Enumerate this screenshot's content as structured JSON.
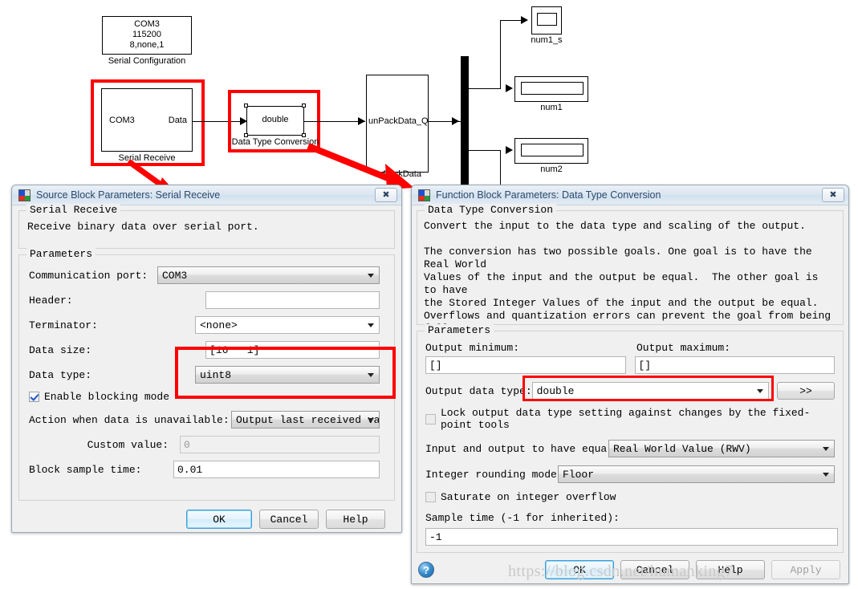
{
  "diagram": {
    "blocks": [
      {
        "name": "serial-configuration",
        "lines": [
          "COM3",
          "115200",
          "8,none,1"
        ],
        "caption": "Serial Configuration"
      },
      {
        "name": "serial-receive",
        "port_in": "COM3",
        "port_out": "Data",
        "caption": "Serial Receive"
      },
      {
        "name": "data-type-conversion",
        "text": "double",
        "caption": "Data Type Conversion"
      },
      {
        "name": "unpackdata",
        "text": "unPackData_Q",
        "caption": "unPackData"
      },
      {
        "name": "display-num1-s",
        "caption": "num1_s"
      },
      {
        "name": "display-num1",
        "caption": "num1"
      },
      {
        "name": "display-num2",
        "caption": "num2"
      }
    ]
  },
  "serial_receive_dialog": {
    "title": "Source Block Parameters: Serial Receive",
    "close_glyph": "✖",
    "group_block": {
      "title": "Serial Receive",
      "description": "Receive binary data over serial port."
    },
    "group_params": {
      "title": "Parameters",
      "communication_port": {
        "label": "Communication port:",
        "value": "COM3"
      },
      "header": {
        "label": "Header:",
        "value": ""
      },
      "terminator": {
        "label": "Terminator:",
        "value": "<none>"
      },
      "data_size": {
        "label": "Data size:",
        "value": "[16   1]"
      },
      "data_type": {
        "label": "Data type:",
        "value": "uint8"
      },
      "enable_blocking": {
        "label": "Enable blocking mode",
        "checked": true
      },
      "action_unavailable": {
        "label": "Action when data is unavailable:",
        "value": "Output last received value"
      },
      "custom_value": {
        "label": "Custom value:",
        "value": "0",
        "disabled": true
      },
      "block_sample_time": {
        "label": "Block sample time:",
        "value": "0.01"
      }
    },
    "buttons": {
      "ok": "OK",
      "cancel": "Cancel",
      "help": "Help"
    }
  },
  "data_type_conversion_dialog": {
    "title": "Function Block Parameters: Data Type Conversion",
    "close_glyph": "✖",
    "group_block": {
      "title": "Data Type Conversion",
      "description": "Convert the input to the data type and scaling of the output.\n\nThe conversion has two possible goals. One goal is to have the Real World\nValues of the input and the output be equal.  The other goal is to have\nthe Stored Integer Values of the input and the output be equal.\nOverflows and quantization errors can prevent the goal from being fully\nachieved."
    },
    "group_params": {
      "title": "Parameters",
      "output_minimum": {
        "label": "Output minimum:",
        "value": "[]"
      },
      "output_maximum": {
        "label": "Output maximum:",
        "value": "[]"
      },
      "output_data_type": {
        "label": "Output data type:",
        "value": "double"
      },
      "show_data_type_assistant": ">>",
      "lock_output": {
        "label": "Lock output data type setting against changes by the fixed-point tools",
        "checked": false
      },
      "input_output_equal": {
        "label": "Input and output to have equal:",
        "value": "Real World Value (RWV)"
      },
      "integer_rounding": {
        "label": "Integer rounding mode:",
        "value": "Floor"
      },
      "saturate_overflow": {
        "label": "Saturate on integer overflow",
        "checked": false
      },
      "sample_time": {
        "label": "Sample time (-1 for inherited):",
        "value": "-1"
      }
    },
    "buttons": {
      "ok": "OK",
      "cancel": "Cancel",
      "help": "Help",
      "apply": "Apply"
    },
    "help_icon_glyph": "?"
  },
  "watermark": {
    "text": "https://blog.csdn.net/humanking7"
  },
  "colors": {
    "highlight_red": "#ff0000",
    "dialog_bg": "#f0f0f0",
    "title_text": "#2c4a6e"
  }
}
